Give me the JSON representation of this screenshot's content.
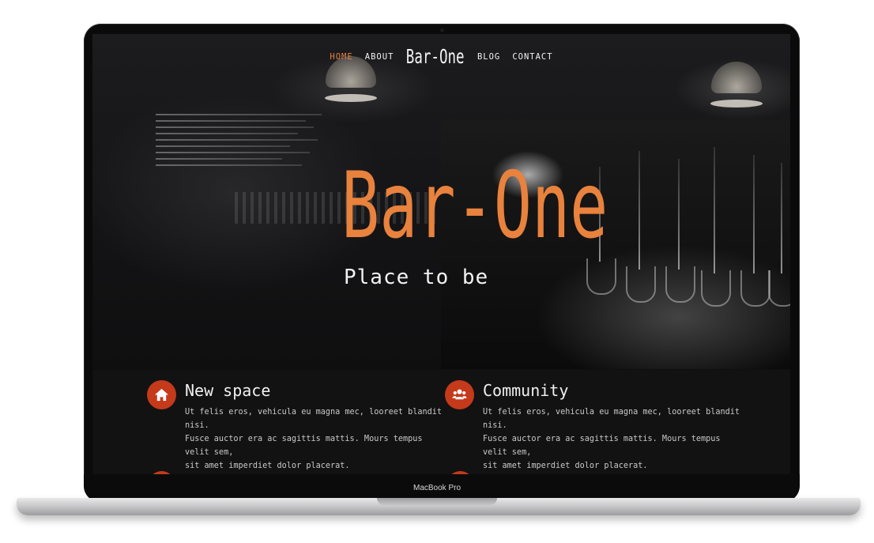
{
  "device": {
    "label": "MacBook Pro"
  },
  "nav": {
    "items": [
      {
        "label": "HOME",
        "active": true
      },
      {
        "label": "ABOUT",
        "active": false
      },
      {
        "label": "BLOG",
        "active": false
      },
      {
        "label": "CONTACT",
        "active": false
      }
    ],
    "logo": "Bar-One"
  },
  "hero": {
    "title": "Bar-One",
    "subtitle": "Place to be"
  },
  "features": [
    {
      "icon": "home-icon",
      "title": "New space",
      "lines": [
        "Ut felis eros, vehicula eu magna mec, looreet blandit nisi.",
        "Fusce auctor era ac sagittis mattis. Mours tempus velit sem,",
        "sit amet imperdiet dolor placerat."
      ]
    },
    {
      "icon": "users-icon",
      "title": "Community",
      "lines": [
        "Ut felis eros, vehicula eu magna mec, looreet blandit nisi.",
        "Fusce auctor era ac sagittis mattis. Mours tempus velit sem,",
        "sit amet imperdiet dolor placerat."
      ]
    }
  ],
  "colors": {
    "accent": "#e8823d",
    "icon_bg": "#c43a1b",
    "background": "#121213"
  }
}
